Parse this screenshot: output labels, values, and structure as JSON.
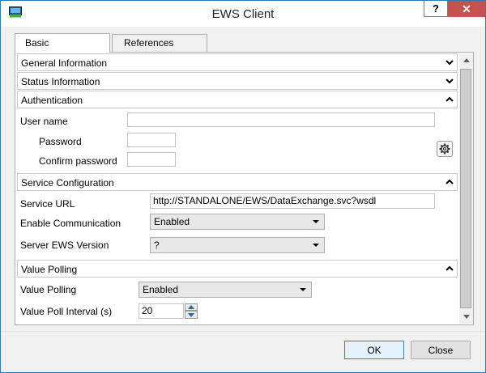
{
  "window": {
    "title": "EWS Client",
    "help_label": "?",
    "close_label": "✕"
  },
  "tabs": [
    {
      "label": "Basic",
      "selected": true
    },
    {
      "label": "References",
      "selected": false
    }
  ],
  "sections": {
    "general": {
      "label": "General Information",
      "expanded": false
    },
    "status": {
      "label": "Status Information",
      "expanded": false
    },
    "authentication": {
      "label": "Authentication",
      "expanded": true
    },
    "service": {
      "label": "Service Configuration",
      "expanded": true
    },
    "polling": {
      "label": "Value Polling",
      "expanded": true
    }
  },
  "auth": {
    "user_name_label": "User name",
    "user_name_value": "",
    "password_label": "Password",
    "confirm_password_label": "Confirm password"
  },
  "service": {
    "url_label": "Service URL",
    "url_value": "http://STANDALONE/EWS/DataExchange.svc?wsdl",
    "enable_label": "Enable Communication",
    "enable_value": "Enabled",
    "version_label": "Server EWS Version",
    "version_value": "?"
  },
  "polling": {
    "value_polling_label": "Value Polling",
    "value_polling_value": "Enabled",
    "interval_label": "Value Poll Interval (s)",
    "interval_value": "20"
  },
  "footer": {
    "ok_label": "OK",
    "close_label": "Close"
  },
  "colors": {
    "window_border": "#2b7bb0",
    "close_button": "#c75050",
    "ok_border": "#3c7fb1"
  }
}
